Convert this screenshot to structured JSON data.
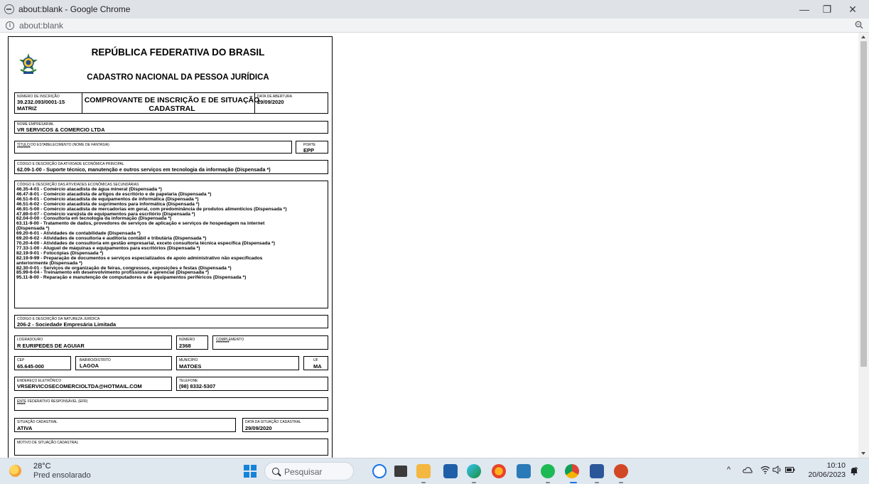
{
  "window": {
    "title": "about:blank - Google Chrome",
    "minimize_glyph": "—",
    "restore_glyph": "❐",
    "close_glyph": "✕"
  },
  "addressbar": {
    "url": "about:blank"
  },
  "document": {
    "republic": "REPÚBLICA FEDERATIVA DO BRASIL",
    "cadastro": "CADASTRO NACIONAL DA PESSOA JURÍDICA",
    "inscricao_label": "NÚMERO DE INSCRIÇÃO",
    "inscricao_value": "39.232.093/0001-15",
    "matriz": "MATRIZ",
    "comprovante_line1": "COMPROVANTE DE INSCRIÇÃO E DE SITUAÇÃO",
    "comprovante_line2": "CADASTRAL",
    "abertura_label": "DATA DE ABERTURA",
    "abertura_value": "29/09/2020",
    "nome_label": "NOME EMPRESARIAL",
    "nome_value": "VR SERVICOS & COMERCIO LTDA",
    "fantasia_label": "TÍTULO DO ESTABELECIMENTO (NOME DE FANTASIA)",
    "fantasia_value": "********",
    "porte_label": "PORTE",
    "porte_value": "EPP",
    "principal_label": "CÓDIGO E DESCRIÇÃO DA ATIVIDADE ECONÔMICA PRINCIPAL",
    "principal_value": "62.09-1-00 - Suporte técnico, manutenção e outros serviços em tecnologia da informação (Dispensada *)",
    "secundarias_label": "CÓDIGO E DESCRIÇÃO DAS ATIVIDADES ECONÔMICAS SECUNDÁRIAS",
    "secundarias": [
      "46.35-4-01 - Comércio atacadista de água mineral (Dispensada *)",
      "46.47-8-01 - Comércio atacadista de artigos de escritório e de papelaria (Dispensada *)",
      "46.51-6-01 - Comércio atacadista de equipamentos de informática (Dispensada *)",
      "46.51-6-02 - Comércio atacadista de suprimentos para informática (Dispensada *)",
      "46.91-5-00 - Comércio atacadista de mercadorias em geral, com predominância de produtos alimentícios (Dispensada *)",
      "47.89-0-07 - Comércio varejista de equipamentos para escritório (Dispensada *)",
      "62.04-0-00 - Consultoria em tecnologia da informação (Dispensada *)",
      "63.11-9-00 - Tratamento de dados, provedores de serviços de aplicação e serviços de hospedagem na internet",
      "(Dispensada *)",
      "69.20-6-01 - Atividades de contabilidade (Dispensada *)",
      "69.20-6-02 - Atividades de consultoria e auditoria contábil e tributária (Dispensada *)",
      "70.20-4-00 - Atividades de consultoria em gestão empresarial, exceto consultoria técnica específica (Dispensada *)",
      "77.33-1-00 - Aluguel de máquinas e equipamentos para escritórios (Dispensada *)",
      "82.19-9-01 - Fotocópias (Dispensada *)",
      "82.19-9-99 - Preparação de documentos e serviços especializados de apoio administrativo não especificados",
      "anteriormente (Dispensada *)",
      "82.30-0-01 - Serviços de organização de feiras, congressos, exposições e festas (Dispensada *)",
      "85.99-6-04 - Treinamento em desenvolvimento profissional e gerencial (Dispensada *)",
      "95.11-8-00 - Reparação e manutenção de computadores e de equipamentos periféricos (Dispensada *)"
    ],
    "natureza_label": "CÓDIGO E DESCRIÇÃO DA NATUREZA JURÍDICA",
    "natureza_value": "206-2 - Sociedade Empresária Limitada",
    "logradouro_label": "LOGRADOURO",
    "logradouro_value": "R EURIPEDES DE AGUIAR",
    "numero_label": "NÚMERO",
    "numero_value": "2368",
    "complemento_label": "COMPLEMENTO",
    "complemento_value": "********",
    "cep_label": "CEP",
    "cep_value": "65.645-000",
    "bairro_label": "BAIRRO/DISTRITO",
    "bairro_value": "LAGOA",
    "municipio_label": "MUNICÍPIO",
    "municipio_value": "MATOES",
    "uf_label": "UF",
    "uf_value": "MA",
    "email_label": "ENDEREÇO ELETRÔNICO",
    "email_value": "VRSERVICOSECOMERCIOLTDA@HOTMAIL.COM",
    "telefone_label": "TELEFONE",
    "telefone_value": "(98) 8332-5307",
    "efr_label": "ENTE FEDERATIVO RESPONSÁVEL (EFR)",
    "efr_value": "*****",
    "situacao_label": "SITUAÇÃO CADASTRAL",
    "situacao_value": "ATIVA",
    "data_situacao_label": "DATA DA SITUAÇÃO CADASTRAL",
    "data_situacao_value": "29/09/2020",
    "motivo_label": "MOTIVO DE SITUAÇÃO CADASTRAL"
  },
  "taskbar": {
    "temperature": "28°C",
    "weather": "Pred ensolarado",
    "search_placeholder": "Pesquisar",
    "time": "10:10",
    "date": "20/06/2023",
    "chevron_glyph": "^"
  },
  "colors": {
    "chrome_titlebar": "#dfe3e8",
    "taskbar": "#dfe7ef",
    "windows_blue": "#1683d8"
  }
}
